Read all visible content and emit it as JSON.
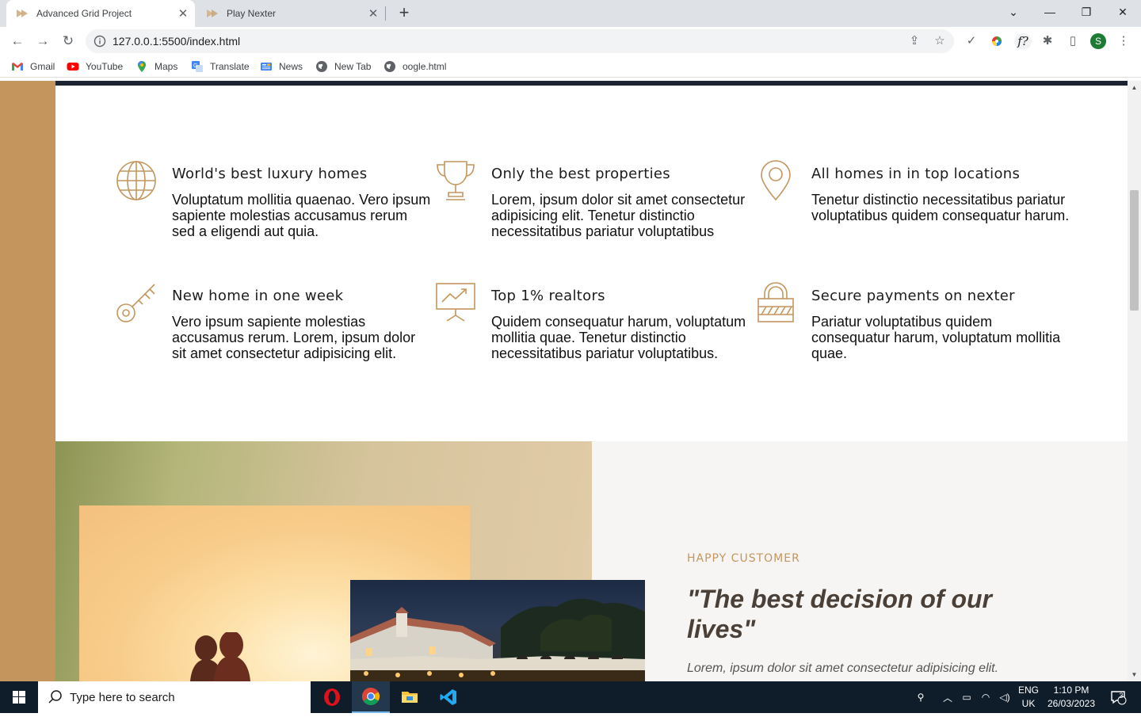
{
  "browser": {
    "tabs": [
      {
        "title": "Advanced Grid Project",
        "active": true
      },
      {
        "title": "Play Nexter",
        "active": false
      }
    ],
    "url": "127.0.0.1:5500/index.html",
    "bookmarks": [
      {
        "label": "Gmail",
        "icon": "gmail-icon"
      },
      {
        "label": "YouTube",
        "icon": "youtube-icon"
      },
      {
        "label": "Maps",
        "icon": "maps-icon"
      },
      {
        "label": "Translate",
        "icon": "translate-icon"
      },
      {
        "label": "News",
        "icon": "news-icon"
      },
      {
        "label": "New Tab",
        "icon": "globe-icon"
      },
      {
        "label": "oogle.html",
        "icon": "globe-icon"
      }
    ],
    "profile_initial": "S",
    "ext_label": "f?"
  },
  "features": [
    {
      "title": "World's best luxury homes",
      "text": "Voluptatum mollitia quaenao. Vero ipsum sapiente molestias accusamus rerum sed a eligendi aut quia.",
      "icon": "globe-icon"
    },
    {
      "title": "Only the best properties",
      "text": "Lorem, ipsum dolor sit amet consectetur adipisicing elit. Tenetur distinctio necessitatibus pariatur voluptatibus",
      "icon": "trophy-icon"
    },
    {
      "title": "All homes in in top locations",
      "text": "Tenetur distinctio necessitatibus pariatur voluptatibus quidem consequatur harum.",
      "icon": "map-pin-icon"
    },
    {
      "title": "New home in one week",
      "text": "Vero ipsum sapiente molestias accusamus rerum. Lorem, ipsum dolor sit amet consectetur adipisicing elit.",
      "icon": "key-icon"
    },
    {
      "title": "Top 1% realtors",
      "text": "Quidem consequatur harum, voluptatum mollitia quae. Tenetur distinctio necessitatibus pariatur voluptatibus.",
      "icon": "presentation-chart-icon"
    },
    {
      "title": "Secure payments on nexter",
      "text": "Pariatur voluptatibus quidem consequatur harum, voluptatum mollitia quae.",
      "icon": "lock-icon"
    }
  ],
  "testimonial": {
    "eyebrow": "HAPPY CUSTOMER",
    "quote": "\"The best decision of our lives\"",
    "text": "Lorem, ipsum dolor sit amet consectetur adipisicing elit."
  },
  "taskbar": {
    "search_placeholder": "Type here to search",
    "lang_line1": "ENG",
    "lang_line2": "UK",
    "time": "1:10 PM",
    "date": "26/03/2023",
    "notification_count": "3"
  },
  "colors": {
    "accent": "#c4965e",
    "heading": "#4a4038",
    "band": "#c4965e"
  }
}
